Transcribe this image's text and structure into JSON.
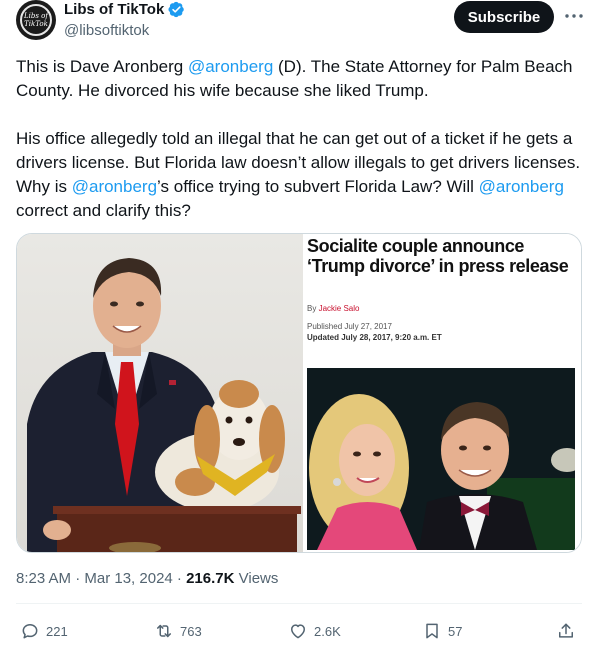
{
  "account": {
    "display_name": "Libs of TikTok",
    "handle": "@libsoftiktok",
    "avatar_text": "Libs of TikTok",
    "verified_icon": "verified-badge-icon",
    "subscribe_label": "Subscribe",
    "more_icon": "more-icon"
  },
  "tweet": {
    "p1_a": "This is Dave Aronberg ",
    "p1_mention": "@aronberg",
    "p1_b": " (D). The State Attorney for Palm Beach County. He divorced his wife because she liked Trump.",
    "p2_a": "His office allegedly told an illegal that he can get out of a ticket if he gets a drivers license. But Florida law doesn’t allow illegals to get drivers licenses. Why is ",
    "p2_mention1": "@aronberg",
    "p2_b": "’s office trying to subvert Florida Law? Will ",
    "p2_mention2": "@aronberg",
    "p2_c": " correct and clarify this?"
  },
  "media": {
    "article_title": "Socialite couple announce ‘Trump divorce’ in press release",
    "byline_prefix": "By ",
    "author": "Jackie Salo",
    "published": "Published July 27, 2017",
    "updated": "Updated July 28, 2017, 9:20 a.m. ET"
  },
  "meta": {
    "time": "8:23 AM · Mar 13, 2024 · ",
    "views_count": "216.7K",
    "views_label": " Views"
  },
  "actions": {
    "replies": "221",
    "reposts": "763",
    "likes": "2.6K",
    "bookmarks": "57"
  },
  "colors": {
    "accent": "#1d9bf0",
    "text": "#0f1419",
    "muted": "#536471",
    "article_author": "#c8102e"
  }
}
